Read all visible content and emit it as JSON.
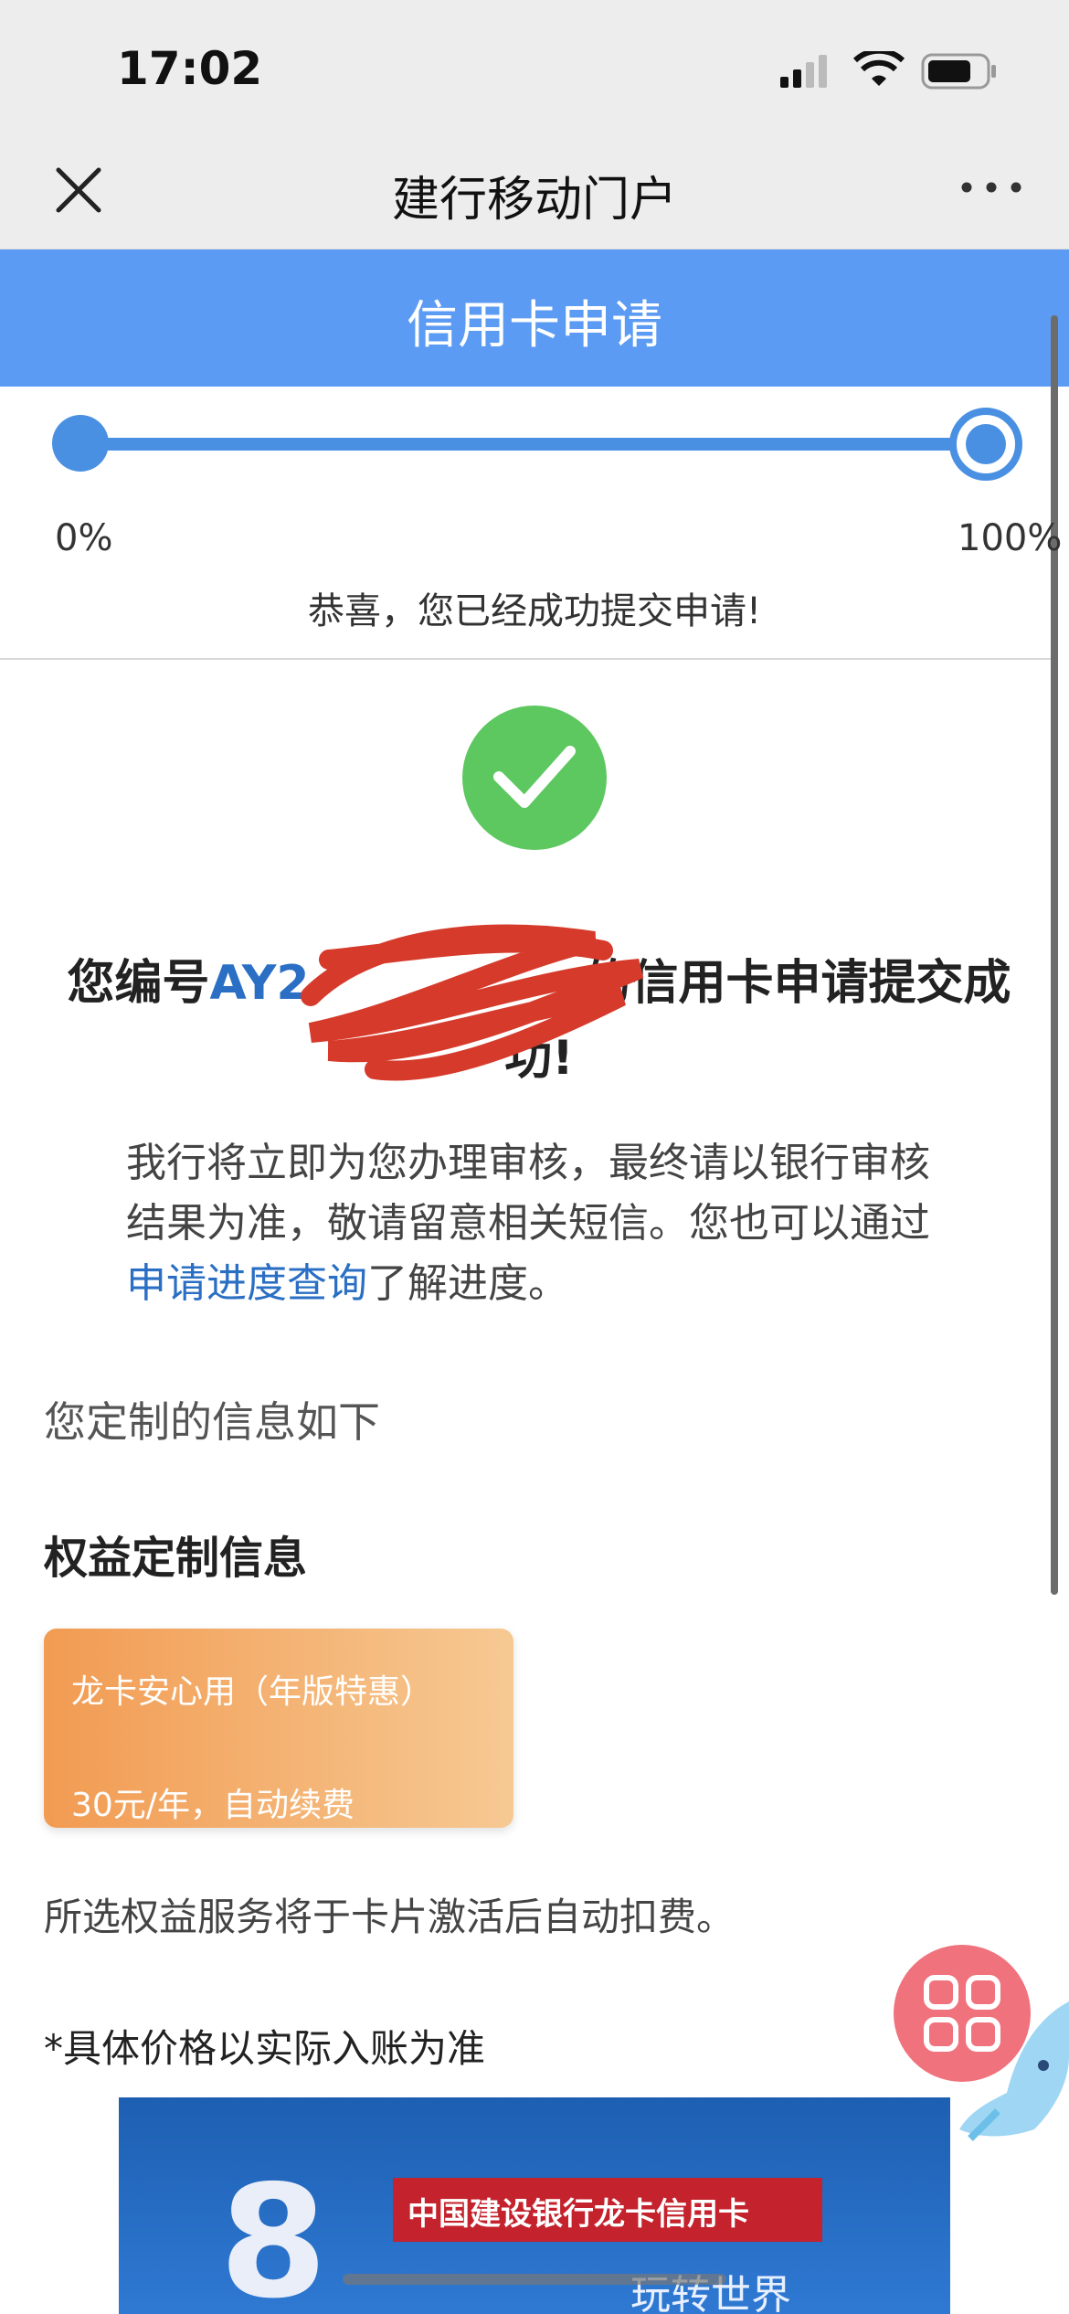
{
  "status_bar": {
    "time": "17:02"
  },
  "nav": {
    "title": "建行移动门户"
  },
  "header": {
    "title": "信用卡申请"
  },
  "progress": {
    "value": 1.0,
    "start_label": "0%",
    "end_label": "100%"
  },
  "congrats": "恭喜，您已经成功提交申请!",
  "result": {
    "prefix": "您编号",
    "app_no": "AY2",
    "suffix": "的信用卡申请提交成功!"
  },
  "body": {
    "text1": "我行将立即为您办理审核，最终请以银行审核结果为准，敬请留意相关短信。您也可以通过",
    "link": "申请进度查询",
    "text2": "了解进度。"
  },
  "custom_info_note": "您定制的信息如下",
  "benefit_section_title": "权益定制信息",
  "benefit_card": {
    "name": "龙卡安心用（年版特惠）",
    "price": "30元/年，自动续费"
  },
  "charge_note": "所选权益服务将于卡片激活后自动扣费。",
  "price_note": "*具体价格以实际入账为准",
  "banner": {
    "title": "中国建设银行龙卡信用卡",
    "number": "8",
    "slogan": "玩转世界"
  },
  "colors": {
    "header_blue": "#5b9bf3",
    "progress_blue": "#4a90e2",
    "success_green": "#5cc85f",
    "link_blue": "#2a6fc4",
    "card_orange": "#f29b52",
    "float_pink": "#f0727d"
  }
}
